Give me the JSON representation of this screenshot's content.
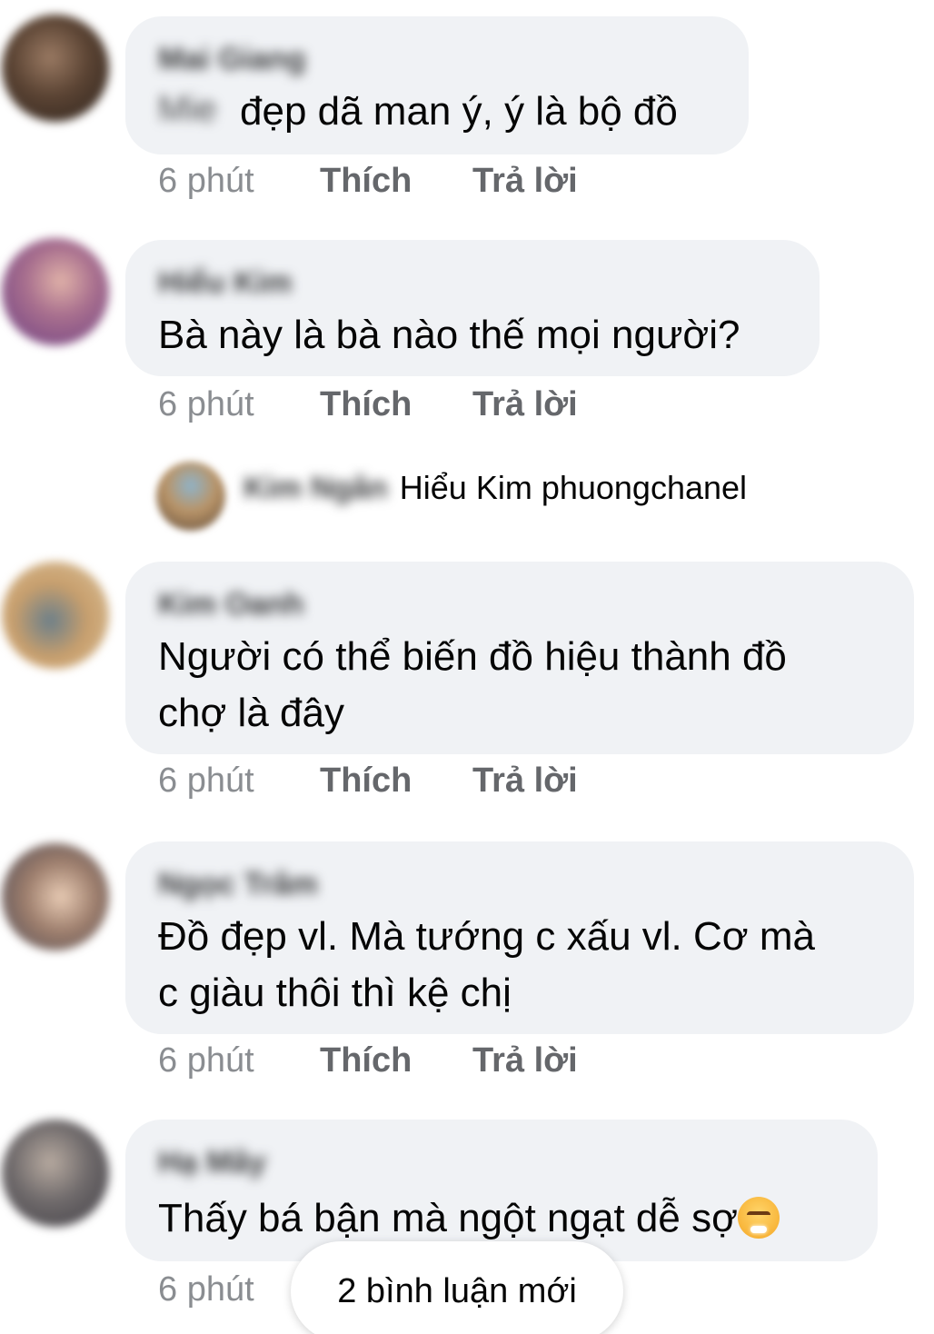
{
  "comments": [
    {
      "author": "Mai Giang",
      "text_prefix": "Mie",
      "text": "đẹp dã man ý, ý là bộ đồ",
      "time": "6 phút",
      "like_label": "Thích",
      "reply_label": "Trả lời"
    },
    {
      "author": "Hiểu Kim",
      "text": "Bà này là bà nào thế mọi người?",
      "time": "6 phút",
      "like_label": "Thích",
      "reply_label": "Trả lời",
      "reply_summary": {
        "author": "Kim Ngân",
        "text": "Hiểu Kim phuongchanel"
      }
    },
    {
      "author": "Kim Oanh",
      "text_line1": "Người có thể biến đồ hiệu thành đồ",
      "text_line2": "chợ là đây",
      "time": "6 phút",
      "like_label": "Thích",
      "reply_label": "Trả lời"
    },
    {
      "author": "Ngọc Trâm",
      "text_line1": "Đồ đẹp vl. Mà tướng c xấu vl. Cơ mà",
      "text_line2": "c giàu thôi thì kệ chị",
      "time": "6 phút",
      "like_label": "Thích",
      "reply_label": "Trả lời"
    },
    {
      "author": "Hạ Mây",
      "text": "Thấy bá bận mà ngột ngạt dễ sợ",
      "emoji_icon": "steam-from-nose-emoji",
      "time": "6 phút"
    }
  ],
  "new_comments_pill": "2 bình luận mới"
}
